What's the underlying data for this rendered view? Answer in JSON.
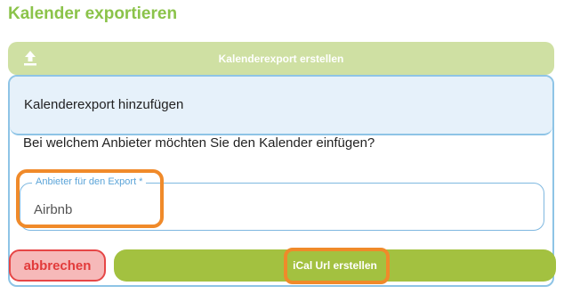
{
  "page": {
    "title": "Kalender exportieren"
  },
  "export_bar": {
    "label": "Kalenderexport erstellen",
    "icon": "upload-icon"
  },
  "panel": {
    "header": "Kalenderexport hinzufügen",
    "question": "Bei welchem Anbieter möchten Sie den Kalender einfügen?",
    "provider_field": {
      "label": "Anbieter für den Export *",
      "value": "Airbnb"
    }
  },
  "actions": {
    "cancel_label": "abbrechen",
    "create_ical_label": "iCal Url erstellen"
  },
  "colors": {
    "title_green": "#8bc34a",
    "export_bar_bg": "#cfe0a3",
    "panel_border": "#8ec4e6",
    "panel_header_bg": "#e6f1fa",
    "cancel_bg": "#f6b9b9",
    "cancel_border": "#e64646",
    "ical_bg": "#a3c140",
    "highlight_orange": "#f08a2a"
  }
}
